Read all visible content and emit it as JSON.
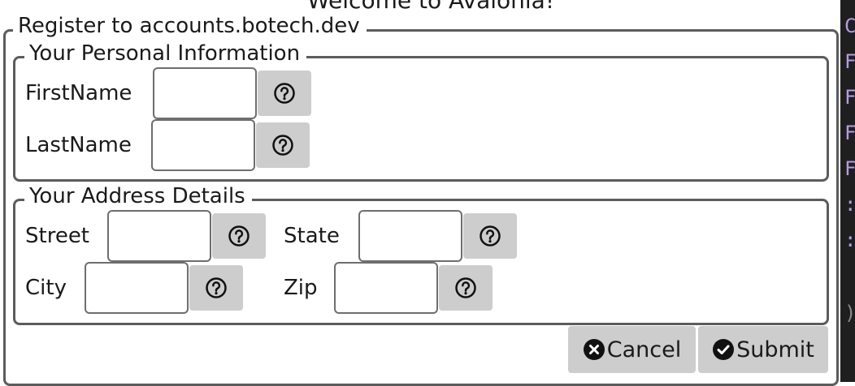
{
  "window": {
    "title": "Welcome to Avalonia!"
  },
  "form": {
    "legend": "Register to accounts.botech.dev",
    "personal": {
      "legend": "Your Personal Information",
      "first_name_label": "FirstName",
      "last_name_label": "LastName",
      "first_name_value": "",
      "last_name_value": ""
    },
    "address": {
      "legend": "Your Address Details",
      "street_label": "Street",
      "state_label": "State",
      "city_label": "City",
      "zip_label": "Zip",
      "street_value": "",
      "state_value": "",
      "city_value": "",
      "zip_value": ""
    },
    "buttons": {
      "cancel": "Cancel",
      "submit": "Submit"
    }
  },
  "editor_strip": {
    "chars": [
      "C",
      "F",
      "F",
      "F",
      "F",
      ":c",
      ":c",
      ")."
    ]
  },
  "colors": {
    "border": "#5c5c5c",
    "button_bg": "#cdcdcd",
    "editor_bg": "#1f1f1f",
    "editor_text": "#b79ae6"
  }
}
